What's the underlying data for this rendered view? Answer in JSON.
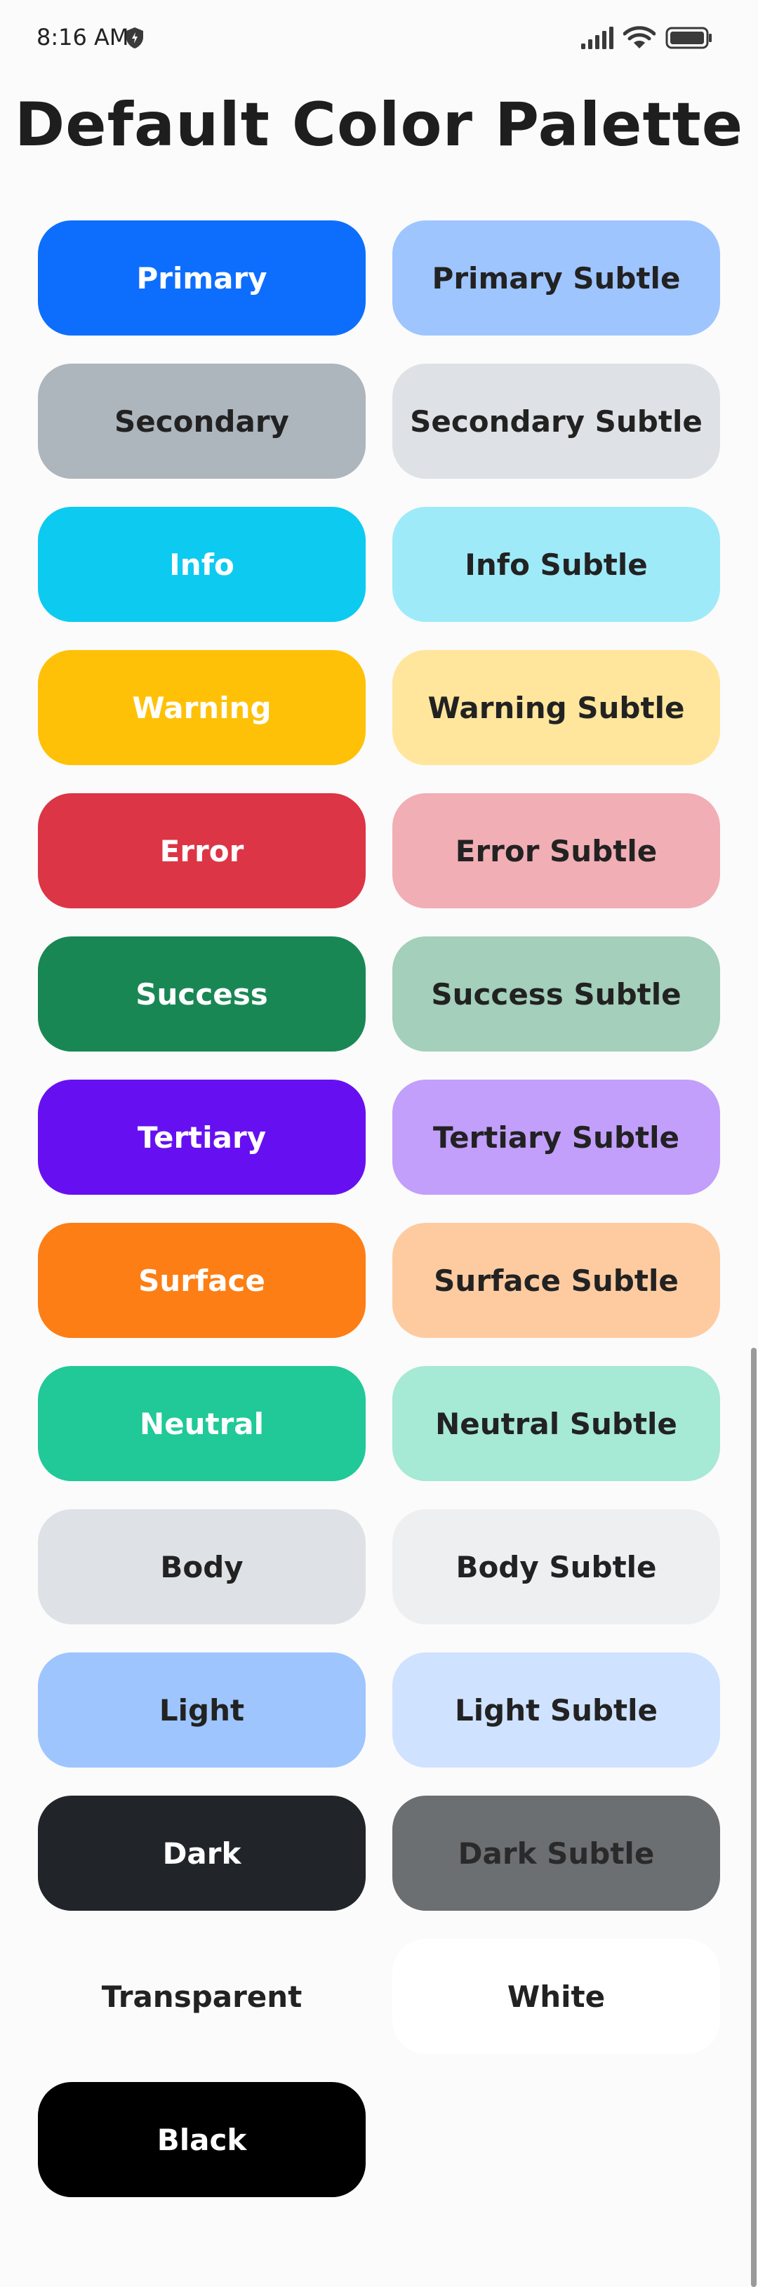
{
  "status_bar": {
    "time": "8:16 AM",
    "icons": [
      "shield-icon",
      "signal-icon",
      "wifi-icon",
      "battery-icon"
    ]
  },
  "page": {
    "title": "Default Color Palette"
  },
  "swatches": [
    {
      "label": "Primary",
      "bg": "#0d6efd",
      "fg": "#ffffff"
    },
    {
      "label": "Primary Subtle",
      "bg": "#9ec5fe",
      "fg": "#222222"
    },
    {
      "label": "Secondary",
      "bg": "#adb5bd",
      "fg": "#222222"
    },
    {
      "label": "Secondary Subtle",
      "bg": "#dee2e6",
      "fg": "#222222"
    },
    {
      "label": "Info",
      "bg": "#0dcaf0",
      "fg": "#ffffff"
    },
    {
      "label": "Info Subtle",
      "bg": "#9eeaf9",
      "fg": "#222222"
    },
    {
      "label": "Warning",
      "bg": "#ffc107",
      "fg": "#ffffff"
    },
    {
      "label": "Warning Subtle",
      "bg": "#ffe69c",
      "fg": "#222222"
    },
    {
      "label": "Error",
      "bg": "#dc3545",
      "fg": "#ffffff"
    },
    {
      "label": "Error Subtle",
      "bg": "#f1aeb5",
      "fg": "#222222"
    },
    {
      "label": "Success",
      "bg": "#198754",
      "fg": "#ffffff"
    },
    {
      "label": "Success Subtle",
      "bg": "#a3cfbb",
      "fg": "#222222"
    },
    {
      "label": "Tertiary",
      "bg": "#6610f2",
      "fg": "#ffffff"
    },
    {
      "label": "Tertiary Subtle",
      "bg": "#c29ffa",
      "fg": "#222222"
    },
    {
      "label": "Surface",
      "bg": "#fd7e14",
      "fg": "#ffffff"
    },
    {
      "label": "Surface Subtle",
      "bg": "#fecba1",
      "fg": "#222222"
    },
    {
      "label": "Neutral",
      "bg": "#20c997",
      "fg": "#ffffff"
    },
    {
      "label": "Neutral Subtle",
      "bg": "#a6e9d5",
      "fg": "#222222"
    },
    {
      "label": "Body",
      "bg": "#dee2e6",
      "fg": "#222222"
    },
    {
      "label": "Body Subtle",
      "bg": "#eeeff1",
      "fg": "#222222"
    },
    {
      "label": "Light",
      "bg": "#9ec5fe",
      "fg": "#222222"
    },
    {
      "label": "Light Subtle",
      "bg": "#cfe2ff",
      "fg": "#222222"
    },
    {
      "label": "Dark",
      "bg": "#212529",
      "fg": "#ffffff"
    },
    {
      "label": "Dark Subtle",
      "bg": "#6c6f72",
      "fg": "#2a2a2a"
    },
    {
      "label": "Transparent",
      "bg": "transparent",
      "fg": "#222222"
    },
    {
      "label": "White",
      "bg": "#ffffff",
      "fg": "#222222"
    },
    {
      "label": "Black",
      "bg": "#000000",
      "fg": "#ffffff"
    }
  ]
}
